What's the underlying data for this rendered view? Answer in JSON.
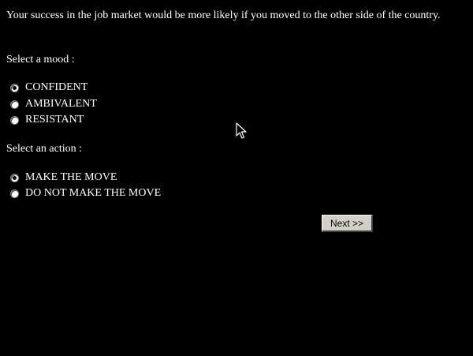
{
  "prompt": "Your success in the job market would be more likely if you moved to the other side of the country.",
  "mood": {
    "label": "Select a mood :",
    "options": [
      {
        "label": "CONFIDENT",
        "checked": true
      },
      {
        "label": "AMBIVALENT",
        "checked": false
      },
      {
        "label": "RESISTANT",
        "checked": false
      }
    ]
  },
  "action": {
    "label": "Select an action :",
    "options": [
      {
        "label": "MAKE THE MOVE",
        "checked": true
      },
      {
        "label": "DO NOT MAKE THE MOVE",
        "checked": false
      }
    ]
  },
  "next_button": {
    "label": "Next >>"
  },
  "cursor_icon": "arrow-cursor-icon",
  "colors": {
    "background": "#000000",
    "text": "#ffffff",
    "button_face": "#d4d0c8"
  }
}
